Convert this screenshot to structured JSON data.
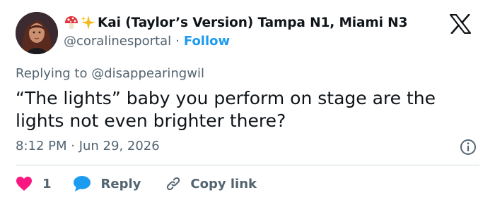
{
  "tweet": {
    "display_name": "Kai (Taylor’s Version) Tampa N1, Miami N3",
    "name_emojis": [
      "mushroom-icon",
      "sparkles-icon"
    ],
    "handle": "@coralinesportal",
    "separator": "·",
    "follow_label": "Follow",
    "replying_to": "Replying to @disappearingwil",
    "text": "“The lights” baby you perform on stage are the lights not even brighter there?",
    "timestamp": "8:12 PM · Jun 29, 2026",
    "like_count": "1",
    "reply_label": "Reply",
    "copy_link_label": "Copy link"
  },
  "icons": {
    "logo": "x-logo-icon",
    "info": "info-icon",
    "like": "heart-icon",
    "reply": "speech-bubble-icon",
    "copy": "link-icon"
  },
  "colors": {
    "text_primary": "#0f1419",
    "text_secondary": "#536471",
    "accent": "#1d9bf0",
    "like": "#f91880",
    "divider": "#cfd9de"
  }
}
